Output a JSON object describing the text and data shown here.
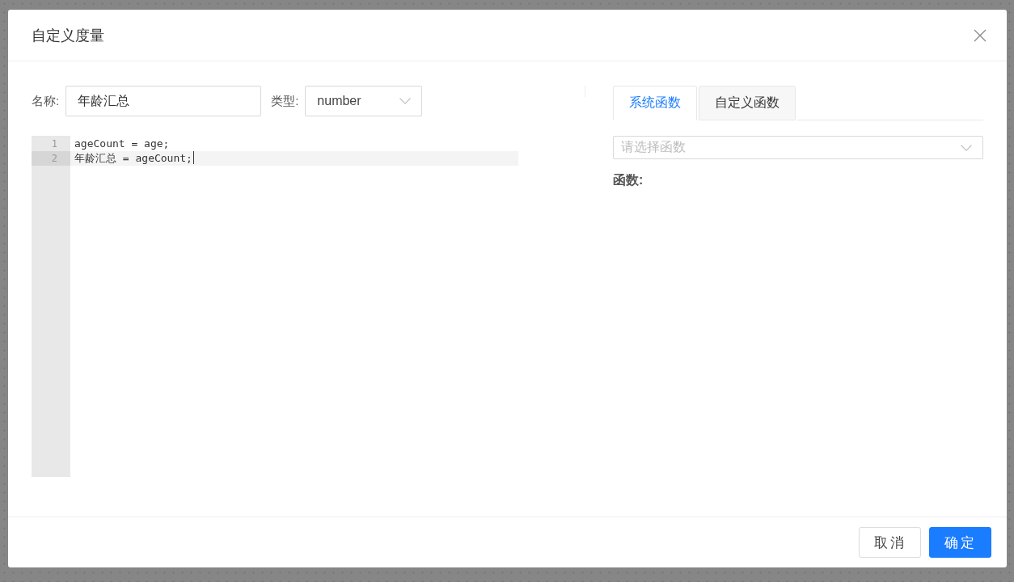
{
  "dialog": {
    "title": "自定义度量"
  },
  "form": {
    "name": {
      "label": "名称:",
      "value": "年龄汇总"
    },
    "type": {
      "label": "类型:",
      "value": "number"
    }
  },
  "editor": {
    "lines": [
      {
        "number": "1",
        "code": "ageCount = age;",
        "active": false
      },
      {
        "number": "2",
        "code": "年龄汇总 = ageCount;",
        "active": true
      }
    ]
  },
  "functions_panel": {
    "tabs": [
      {
        "label": "系统函数",
        "selected": true
      },
      {
        "label": "自定义函数",
        "selected": false
      }
    ],
    "select": {
      "placeholder": "请选择函数"
    },
    "function_label": "函数:"
  },
  "buttons": [
    {
      "label": "取消",
      "kind": "default"
    },
    {
      "label": "确定",
      "kind": "primary"
    }
  ]
}
